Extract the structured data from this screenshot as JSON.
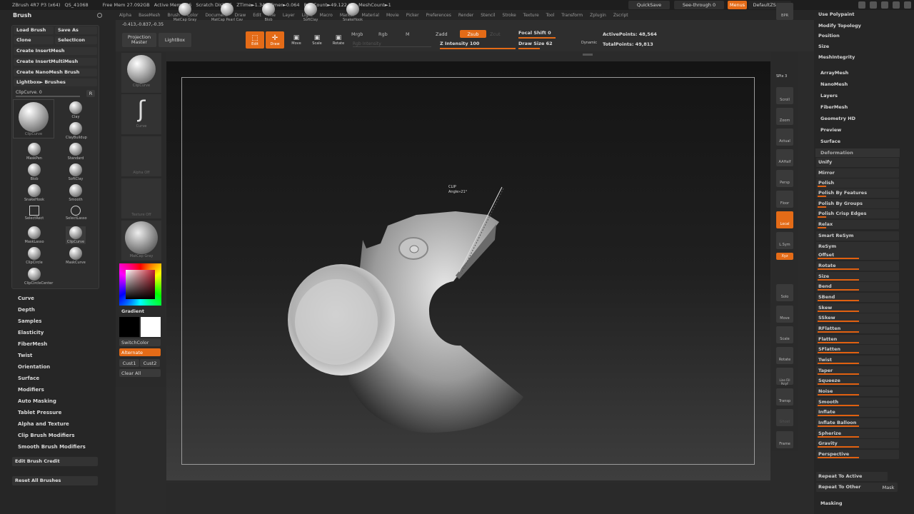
{
  "topbar": {
    "app": "ZBrush 4R7 P3 (x64)",
    "qs": "QS_41068",
    "free_mem": "Free Mem 27.092GB",
    "active_mem": "Active Mem 856",
    "scratch": "Scratch Disk 75",
    "ztime": "ZTime►1.340 Timer►0.064",
    "polycount": "PolyCount►49.122 KP",
    "meshcount": "MeshCount►1",
    "quicksave": "QuickSave",
    "seethrough": "See-through  0",
    "menus": "Menus",
    "defaultzscript": "DefaultZScript"
  },
  "menubar": [
    "Alpha",
    "BaseMesh",
    "Brush",
    "Color",
    "Document",
    "Draw",
    "Edit",
    "File",
    "Layer",
    "Light",
    "Macro",
    "Marker",
    "Material",
    "Movie",
    "Picker",
    "Preferences",
    "Render",
    "Stencil",
    "Stroke",
    "Texture",
    "Tool",
    "Transform",
    "Zplugin",
    "Zscript"
  ],
  "toolbar": {
    "coords": "-0.413,-0.837,-0.35",
    "projection_master": "Projection Master",
    "lightbox": "LightBox",
    "edit": "Edit",
    "draw": "Draw",
    "move": "Move",
    "scale": "Scale",
    "rotate": "Rotate",
    "mrgb": "Mrgb",
    "rgb": "Rgb",
    "m": "M",
    "rgb_intensity": "Rgb Intensity",
    "zadd": "Zadd",
    "zsub": "Zsub",
    "zcut": "Zcut",
    "z_intensity": "Z Intensity 100",
    "focal_shift": "Focal Shift 0",
    "draw_size": "Draw Size 62",
    "dynamic": "Dynamic",
    "active_points": "ActivePoints: 48,564",
    "total_points": "TotalPoints: 49,813"
  },
  "left": {
    "title": "Brush",
    "buttons": [
      "Load Brush",
      "Save As",
      "Clone",
      "SelectIcon",
      "Create InsertMesh",
      "Create InsertMultiMesh",
      "Create NanoMesh Brush",
      "Lightbox► Brushes"
    ],
    "clipcurve_label": "ClipCurve. 0",
    "r": "R",
    "current_brush": "ClipCurve",
    "brushes": [
      "Clay",
      "ClayBuildup",
      "MaskPen",
      "Standard",
      "Blob",
      "SoftClay",
      "SnakeHook",
      "Smooth",
      "SelectRect",
      "SelectLasso",
      "MaskLasso",
      "ClipCurve",
      "ClipCircle",
      "MaskCurve",
      "ClipCircleCenter"
    ],
    "menus": [
      "Curve",
      "Depth",
      "Samples",
      "Elasticity",
      "FiberMesh",
      "Twist",
      "Orientation",
      "Surface",
      "Modifiers",
      "Auto Masking",
      "Tablet Pressure",
      "Alpha and Texture",
      "Clip Brush Modifiers",
      "Smooth Brush Modifiers"
    ],
    "edit_credit": "Edit Brush Credit",
    "reset": "Reset All Brushes"
  },
  "shelf": {
    "slots": [
      "ClipCurve",
      "Curve",
      "Alpha Off",
      "Texture Off",
      "MatCap Gray"
    ],
    "gradient": "Gradient",
    "switchcolor": "SwitchColor",
    "alternate": "Alternate",
    "cust1": "Cust1",
    "cust2": "Cust2",
    "clear_all": "Clear All"
  },
  "canvas": {
    "clip_label": "CLIP",
    "angle_label": "Angle»21°"
  },
  "right_shelf": [
    "BPR",
    "SPix 3",
    "Scroll",
    "Zoom",
    "Actual",
    "AAHalf",
    "Persp",
    "Floor",
    "Local",
    "L.Sym",
    "Xyz",
    "Solo",
    "Move",
    "Scale",
    "Rotate",
    "Line Fill PolyF",
    "Transp",
    "Ghost",
    "Frame"
  ],
  "right": {
    "top_items": [
      "Use Polypaint",
      "Modify Topology",
      "Position",
      "Size",
      "MeshIntegrity",
      "ArrayMesh",
      "NanoMesh",
      "Layers",
      "FiberMesh",
      "Geometry HD",
      "Preview",
      "Surface"
    ],
    "deformation": "Deformation",
    "deform_items": [
      "Unify",
      "Mirror",
      "Polish",
      "Polish By Features",
      "Polish By Groups",
      "Polish Crisp Edges",
      "Relax",
      "Smart ReSym",
      "ReSym",
      "Offset",
      "Rotate",
      "Size",
      "Bend",
      "SBend",
      "Skew",
      "SSkew",
      "RFlatten",
      "Flatten",
      "SFlatten",
      "Twist",
      "Taper",
      "Squeeze",
      "Noise",
      "Smooth",
      "Inflate",
      "Inflate Balloon",
      "Spherize",
      "Gravity",
      "Perspective",
      "Repeat To Active",
      "Repeat To Other"
    ],
    "mask": "Mask",
    "masking": "Masking"
  },
  "bottom": [
    "MatCap Gray",
    "MatCap Pearl Cav",
    "Blob",
    "SoftClay",
    "SnakeHook"
  ],
  "colors": {
    "accent": "#e46b17",
    "panel": "#262626",
    "viewport": "#1a1a1a"
  }
}
